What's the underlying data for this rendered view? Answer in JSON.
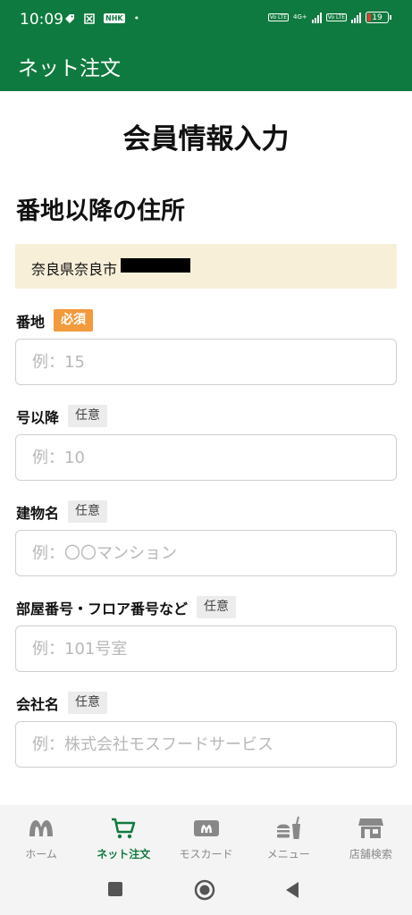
{
  "status_bar": {
    "time": "10:09",
    "nhk": "NHK",
    "volte": "Vo LTE",
    "network": "4G+",
    "battery": "19"
  },
  "app_bar": {
    "title": "ネット注文"
  },
  "page_title": "会員情報入力",
  "section_title": "番地以降の住所",
  "prefilled_address": "奈良県奈良市",
  "fields": [
    {
      "label": "番地",
      "badge": "必須",
      "badge_type": "required",
      "placeholder": "例：15"
    },
    {
      "label": "号以降",
      "badge": "任意",
      "badge_type": "optional",
      "placeholder": "例：10"
    },
    {
      "label": "建物名",
      "badge": "任意",
      "badge_type": "optional",
      "placeholder": "例：〇〇マンション"
    },
    {
      "label": "部屋番号・フロア番号など",
      "badge": "任意",
      "badge_type": "optional",
      "placeholder": "例：101号室"
    },
    {
      "label": "会社名",
      "badge": "任意",
      "badge_type": "optional",
      "placeholder": "例：株式会社モスフードサービス"
    }
  ],
  "bottom_nav": [
    {
      "label": "ホーム",
      "icon": "mos-logo-icon",
      "active": false
    },
    {
      "label": "ネット注文",
      "icon": "cart-icon",
      "active": true
    },
    {
      "label": "モスカード",
      "icon": "card-icon",
      "active": false
    },
    {
      "label": "メニュー",
      "icon": "burger-drink-icon",
      "active": false
    },
    {
      "label": "店舗検索",
      "icon": "store-icon",
      "active": false
    }
  ],
  "colors": {
    "brand": "#0f7a3f",
    "required": "#f39a3c",
    "prefilled_bg": "#f8efd9",
    "nav_inactive": "#888888"
  }
}
